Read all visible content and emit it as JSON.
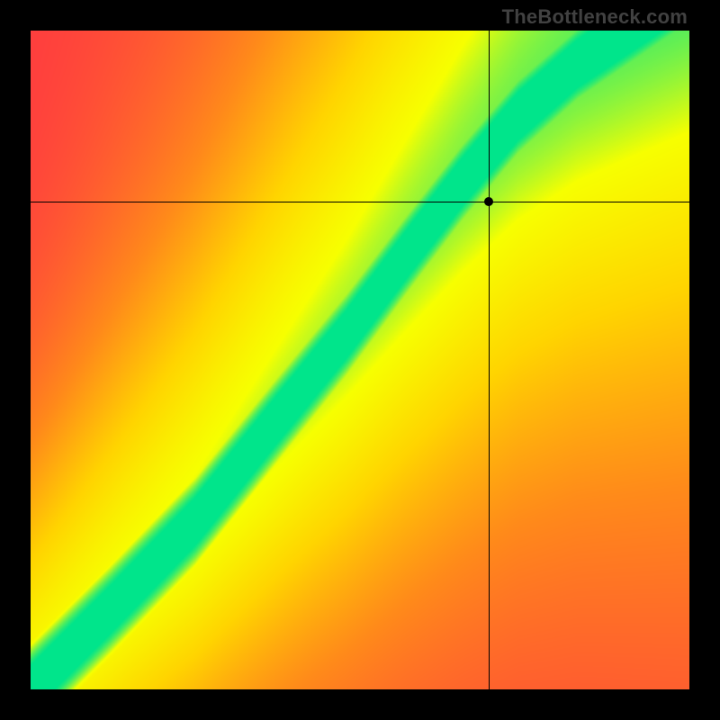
{
  "watermark": "TheBottleneck.com",
  "chart_data": {
    "type": "heatmap",
    "title": "",
    "xlabel": "",
    "ylabel": "",
    "xlim": [
      0,
      1
    ],
    "ylim": [
      0,
      1
    ],
    "colorscale": [
      {
        "stop": 0.0,
        "color": "#ff2b47"
      },
      {
        "stop": 0.38,
        "color": "#ff8a1a"
      },
      {
        "stop": 0.62,
        "color": "#ffd400"
      },
      {
        "stop": 0.82,
        "color": "#f7ff00"
      },
      {
        "stop": 0.985,
        "color": "#00e58b"
      }
    ],
    "ridge": {
      "description": "narrow green band where values peak (match quality)",
      "control_points_xy": [
        [
          0.0,
          0.0
        ],
        [
          0.12,
          0.12
        ],
        [
          0.25,
          0.255
        ],
        [
          0.37,
          0.405
        ],
        [
          0.48,
          0.54
        ],
        [
          0.57,
          0.66
        ],
        [
          0.655,
          0.77
        ],
        [
          0.74,
          0.87
        ],
        [
          0.83,
          0.95
        ],
        [
          0.92,
          1.01
        ]
      ],
      "band_halfwidth": 0.04
    },
    "crosshair": {
      "x": 0.695,
      "y": 0.74
    },
    "marker": {
      "x": 0.695,
      "y": 0.74
    },
    "grid": false,
    "legend": false
  }
}
